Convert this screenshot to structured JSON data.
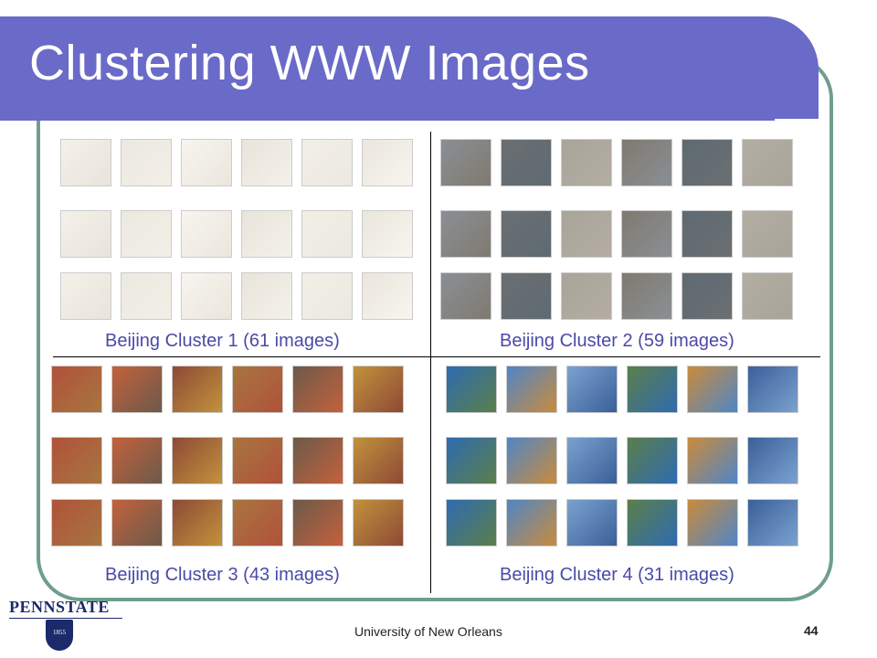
{
  "slide": {
    "title": "Clustering WWW Images",
    "footer": "University of New Orleans",
    "page_number": "44",
    "logo_text": "PENNSTATE",
    "logo_year": "1855"
  },
  "clusters": [
    {
      "caption": "Beijing Cluster 1 (61 images)"
    },
    {
      "caption": "Beijing Cluster 2 (59 images)"
    },
    {
      "caption": "Beijing Cluster 3 (43 images)"
    },
    {
      "caption": "Beijing Cluster 4 (31 images)"
    }
  ],
  "colors": {
    "title_band": "#6a6ac9",
    "frame": "#6f9e8e",
    "caption": "#4a4aa8"
  }
}
